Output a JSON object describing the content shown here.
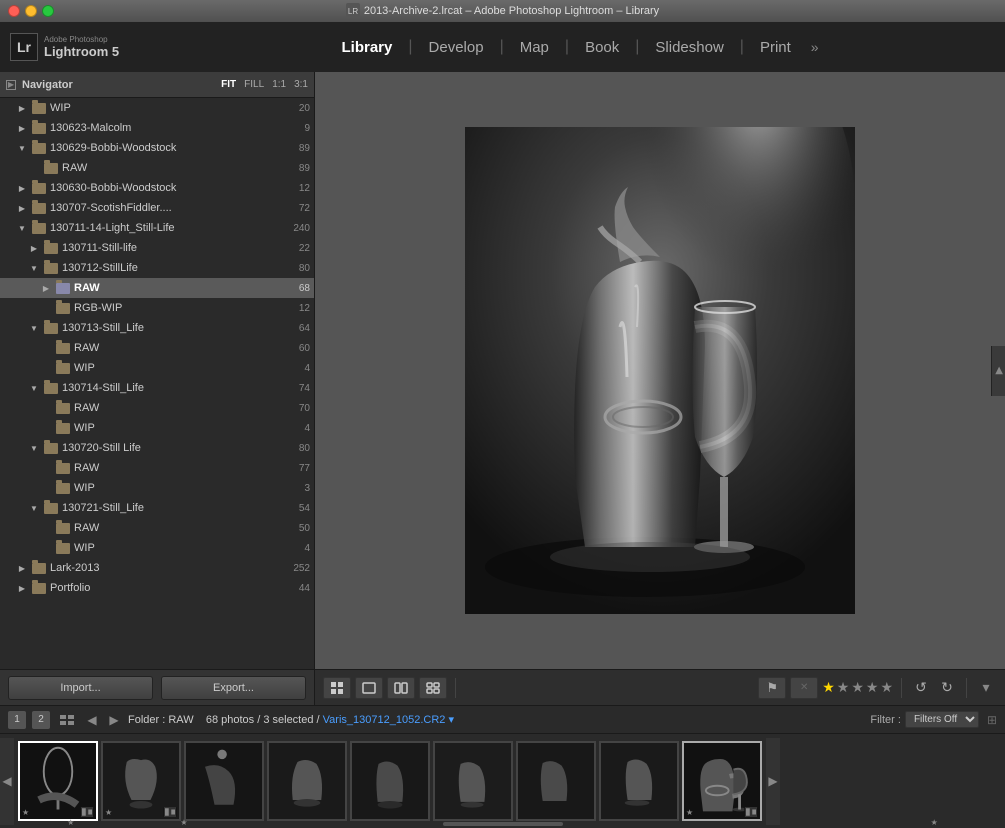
{
  "window": {
    "title": "2013-Archive-2.lrcat – Adobe Photoshop Lightroom – Library"
  },
  "logo": {
    "lr_char": "Lr",
    "adobe_text": "Adobe Photoshop",
    "product_name": "Lightroom 5"
  },
  "nav_tabs": [
    {
      "id": "library",
      "label": "Library",
      "active": true
    },
    {
      "id": "develop",
      "label": "Develop",
      "active": false
    },
    {
      "id": "map",
      "label": "Map",
      "active": false
    },
    {
      "id": "book",
      "label": "Book",
      "active": false
    },
    {
      "id": "slideshow",
      "label": "Slideshow",
      "active": false
    },
    {
      "id": "print",
      "label": "Print",
      "active": false
    }
  ],
  "navigator": {
    "title": "Navigator",
    "zoom_options": [
      "FIT",
      "FILL",
      "1:1",
      "3:1"
    ],
    "active_zoom": "FIT"
  },
  "folders": [
    {
      "id": "wip",
      "label": "WIP",
      "count": 20,
      "indent": 1,
      "expanded": false,
      "has_children": false
    },
    {
      "id": "130623",
      "label": "130623-Malcolm",
      "count": 9,
      "indent": 1,
      "expanded": false,
      "has_children": false
    },
    {
      "id": "130629",
      "label": "130629-Bobbi-Woodstock",
      "count": 89,
      "indent": 1,
      "expanded": true,
      "has_children": true
    },
    {
      "id": "130629-raw",
      "label": "RAW",
      "count": 89,
      "indent": 2,
      "expanded": false,
      "has_children": false
    },
    {
      "id": "130630",
      "label": "130630-Bobbi-Woodstock",
      "count": 12,
      "indent": 1,
      "expanded": false,
      "has_children": false
    },
    {
      "id": "130707",
      "label": "130707-ScotishFiddler....",
      "count": 72,
      "indent": 1,
      "expanded": false,
      "has_children": false
    },
    {
      "id": "130711-14",
      "label": "130711-14-Light_Still-Life",
      "count": 240,
      "indent": 1,
      "expanded": true,
      "has_children": true
    },
    {
      "id": "130711",
      "label": "130711-Still-life",
      "count": 22,
      "indent": 2,
      "expanded": false,
      "has_children": false
    },
    {
      "id": "130712",
      "label": "130712-StillLife",
      "count": 80,
      "indent": 2,
      "expanded": true,
      "has_children": true
    },
    {
      "id": "130712-raw",
      "label": "RAW",
      "count": 68,
      "indent": 3,
      "expanded": false,
      "has_children": false,
      "selected": true
    },
    {
      "id": "130712-rgb",
      "label": "RGB-WIP",
      "count": 12,
      "indent": 3,
      "expanded": false,
      "has_children": false
    },
    {
      "id": "130713",
      "label": "130713-Still_Life",
      "count": 64,
      "indent": 2,
      "expanded": true,
      "has_children": true
    },
    {
      "id": "130713-raw",
      "label": "RAW",
      "count": 60,
      "indent": 3,
      "expanded": false,
      "has_children": false
    },
    {
      "id": "130713-wip",
      "label": "WIP",
      "count": 4,
      "indent": 3,
      "expanded": false,
      "has_children": false
    },
    {
      "id": "130714",
      "label": "130714-Still_Life",
      "count": 74,
      "indent": 2,
      "expanded": true,
      "has_children": true
    },
    {
      "id": "130714-raw",
      "label": "RAW",
      "count": 70,
      "indent": 3,
      "expanded": false,
      "has_children": false
    },
    {
      "id": "130714-wip",
      "label": "WIP",
      "count": 4,
      "indent": 3,
      "expanded": false,
      "has_children": false
    },
    {
      "id": "130720",
      "label": "130720-Still Life",
      "count": 80,
      "indent": 2,
      "expanded": true,
      "has_children": true
    },
    {
      "id": "130720-raw",
      "label": "RAW",
      "count": 77,
      "indent": 3,
      "expanded": false,
      "has_children": false
    },
    {
      "id": "130720-wip",
      "label": "WIP",
      "count": 3,
      "indent": 3,
      "expanded": false,
      "has_children": false
    },
    {
      "id": "130721",
      "label": "130721-Still_Life",
      "count": 54,
      "indent": 2,
      "expanded": true,
      "has_children": true
    },
    {
      "id": "130721-raw",
      "label": "RAW",
      "count": 50,
      "indent": 3,
      "expanded": false,
      "has_children": false
    },
    {
      "id": "130721-wip",
      "label": "WIP",
      "count": 4,
      "indent": 3,
      "expanded": false,
      "has_children": false
    },
    {
      "id": "lark-2013",
      "label": "Lark-2013",
      "count": 252,
      "indent": 1,
      "expanded": false,
      "has_children": false
    },
    {
      "id": "portfolio",
      "label": "Portfolio",
      "count": 44,
      "indent": 1,
      "expanded": false,
      "has_children": false
    }
  ],
  "import_button": "Import...",
  "export_button": "Export...",
  "toolbar": {
    "view_buttons": [
      "grid",
      "loupe",
      "compare",
      "survey"
    ],
    "rating": 1,
    "max_rating": 5
  },
  "filmstrip_bar": {
    "page1": "1",
    "page2": "2",
    "folder_label": "Folder : RAW",
    "photo_info": "68 photos / 3 selected /",
    "filename": "Varis_130712_1052.CR2",
    "filter_label": "Filter :",
    "filter_value": "Filters Off"
  },
  "filmstrip": {
    "thumbs": [
      {
        "id": 1,
        "selected": true,
        "has_badge": true
      },
      {
        "id": 2,
        "selected": false,
        "has_badge": true
      },
      {
        "id": 3,
        "selected": false,
        "has_badge": false
      },
      {
        "id": 4,
        "selected": false,
        "has_badge": false
      },
      {
        "id": 5,
        "selected": false,
        "has_badge": false
      },
      {
        "id": 6,
        "selected": false,
        "has_badge": false
      },
      {
        "id": 7,
        "selected": false,
        "has_badge": false
      },
      {
        "id": 8,
        "selected": false,
        "has_badge": false
      },
      {
        "id": 9,
        "selected": true,
        "has_badge": true
      }
    ]
  }
}
